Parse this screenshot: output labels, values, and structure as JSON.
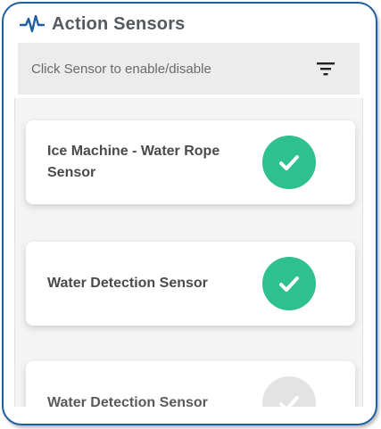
{
  "header": {
    "title": "Action Sensors",
    "icon": "pulse-icon"
  },
  "filter_bar": {
    "hint": "Click Sensor to enable/disable",
    "icon": "filter-icon"
  },
  "colors": {
    "accent": "#1d5fa0",
    "enabled": "#2ec08e",
    "disabled": "#e3e3e3"
  },
  "sensors": [
    {
      "label": "Ice Machine - Water Rope Sensor",
      "enabled": true
    },
    {
      "label": "Water Detection Sensor",
      "enabled": true
    },
    {
      "label": "Water Detection Sensor",
      "enabled": false
    }
  ]
}
